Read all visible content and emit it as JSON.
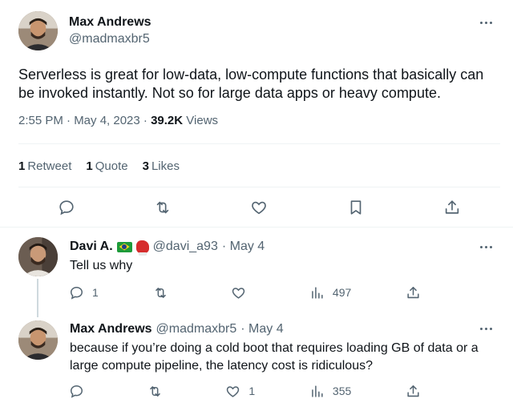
{
  "tweet": {
    "author_name": "Max Andrews",
    "author_handle": "@madmaxbr5",
    "text": "Serverless is great for low-data, low-compute functions that basically can be invoked instantly. Not so for large data apps or heavy compute.",
    "time": "2:55 PM · May 4, 2023 · ",
    "views_count": "39.2K",
    "views_label": "Views",
    "stats": {
      "retweets_count": "1",
      "retweets_label": "Retweet",
      "quotes_count": "1",
      "quotes_label": "Quote",
      "likes_count": "3",
      "likes_label": "Likes"
    }
  },
  "replies": [
    {
      "name": "Davi A.",
      "handle": "@davi_a93",
      "date": "· May 4",
      "text": "Tell us why",
      "reply_count": "1",
      "retweet_count": "",
      "like_count": "",
      "view_count": "497"
    },
    {
      "name": "Max Andrews",
      "handle": "@madmaxbr5",
      "date": "· May 4",
      "text": "because if you’re doing a cold boot that requires loading GB of data or a large compute pipeline, the latency cost is ridiculous?",
      "reply_count": "",
      "retweet_count": "",
      "like_count": "1",
      "view_count": "355"
    }
  ],
  "colors": {
    "text": "#0f1419",
    "muted": "#536471",
    "divider": "#eff3f4"
  },
  "icons": [
    "reply-icon",
    "retweet-icon",
    "like-icon",
    "bookmark-icon",
    "share-icon",
    "views-icon",
    "more-icon"
  ]
}
